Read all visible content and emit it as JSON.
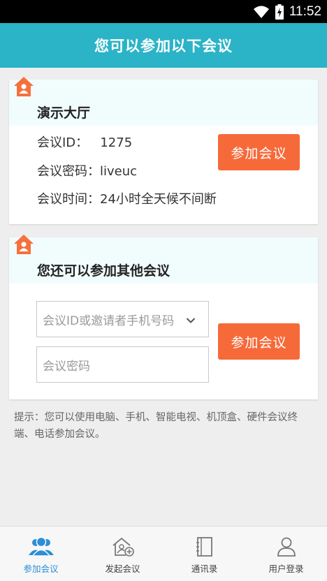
{
  "status_bar": {
    "time": "11:52"
  },
  "app_bar": {
    "title": "您可以参加以下会议"
  },
  "hall_card": {
    "title": "演示大厅",
    "meeting_id_line": "会议ID：   1275",
    "password_line": "会议密码：liveuc",
    "time_line": "会议时间：24小时全天候不间断",
    "join_label": "参加会议"
  },
  "other_card": {
    "title": "您还可以参加其他会议",
    "id_placeholder": "会议ID或邀请者手机号码",
    "password_placeholder": "会议密码",
    "join_label": "参加会议"
  },
  "hint": "提示：您可以使用电脑、手机、智能电视、机顶盒、硬件会议终端、电话参加会议。",
  "bottom_nav": {
    "items": [
      {
        "label": "参加会议",
        "icon": "people-icon",
        "active": true
      },
      {
        "label": "发起会议",
        "icon": "house-plus-icon",
        "active": false
      },
      {
        "label": "通讯录",
        "icon": "address-book-icon",
        "active": false
      },
      {
        "label": "用户登录",
        "icon": "user-icon",
        "active": false
      }
    ]
  },
  "colors": {
    "app_bar": "#2bb3c7",
    "button": "#f66a3a",
    "badge": "#f4713d",
    "nav_active": "#2b8fd6"
  }
}
